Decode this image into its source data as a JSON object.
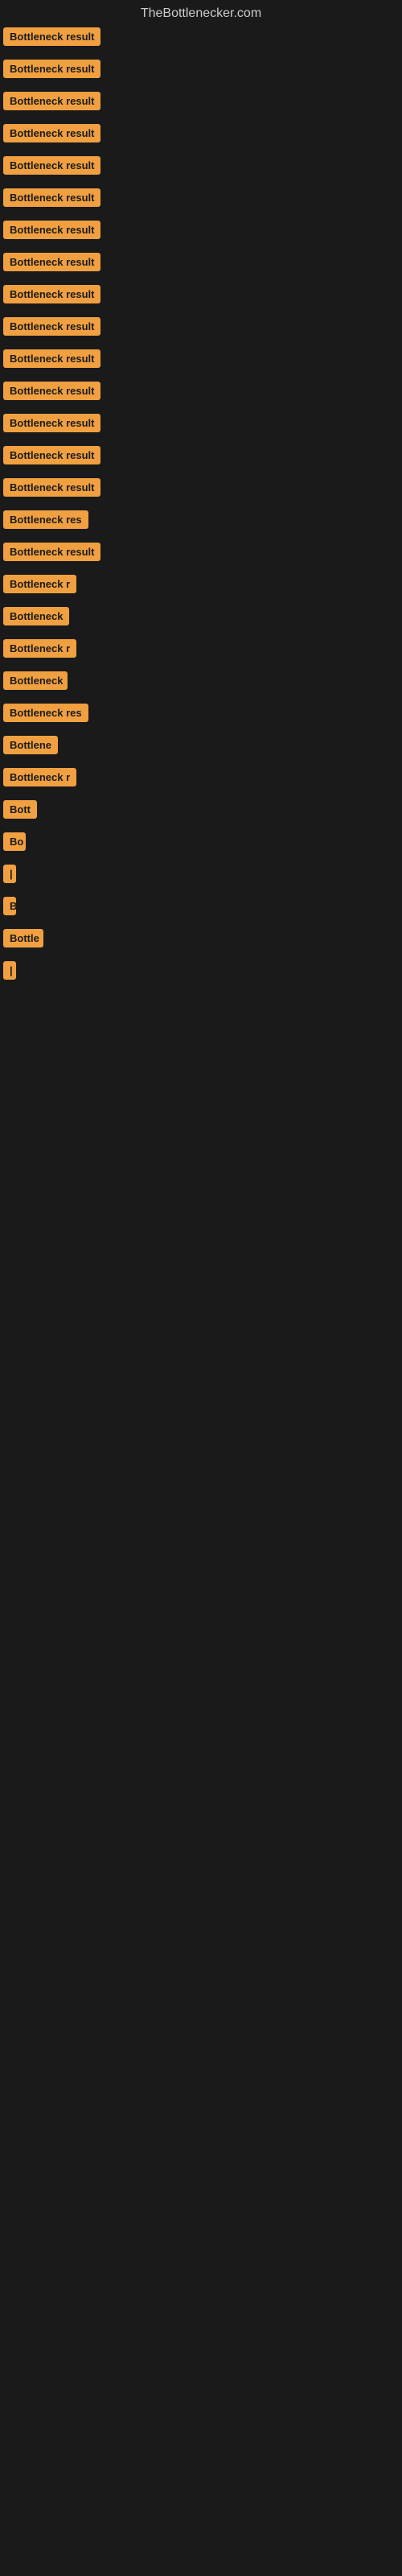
{
  "header": {
    "title": "TheBottlenecker.com"
  },
  "items": [
    {
      "label": "Bottleneck result",
      "width": 150
    },
    {
      "label": "Bottleneck result",
      "width": 150
    },
    {
      "label": "Bottleneck result",
      "width": 150
    },
    {
      "label": "Bottleneck result",
      "width": 150
    },
    {
      "label": "Bottleneck result",
      "width": 150
    },
    {
      "label": "Bottleneck result",
      "width": 150
    },
    {
      "label": "Bottleneck result",
      "width": 150
    },
    {
      "label": "Bottleneck result",
      "width": 150
    },
    {
      "label": "Bottleneck result",
      "width": 150
    },
    {
      "label": "Bottleneck result",
      "width": 150
    },
    {
      "label": "Bottleneck result",
      "width": 150
    },
    {
      "label": "Bottleneck result",
      "width": 150
    },
    {
      "label": "Bottleneck result",
      "width": 150
    },
    {
      "label": "Bottleneck result",
      "width": 145
    },
    {
      "label": "Bottleneck result",
      "width": 140
    },
    {
      "label": "Bottleneck res",
      "width": 122
    },
    {
      "label": "Bottleneck result",
      "width": 156
    },
    {
      "label": "Bottleneck r",
      "width": 100
    },
    {
      "label": "Bottleneck",
      "width": 82
    },
    {
      "label": "Bottleneck r",
      "width": 100
    },
    {
      "label": "Bottleneck",
      "width": 80
    },
    {
      "label": "Bottleneck res",
      "width": 122
    },
    {
      "label": "Bottlene",
      "width": 70
    },
    {
      "label": "Bottleneck r",
      "width": 98
    },
    {
      "label": "Bott",
      "width": 42
    },
    {
      "label": "Bo",
      "width": 28
    },
    {
      "label": "|",
      "width": 10
    },
    {
      "label": "B",
      "width": 16
    },
    {
      "label": "Bottle",
      "width": 50
    },
    {
      "label": "|",
      "width": 10
    },
    {
      "label": "",
      "width": 0
    },
    {
      "label": "",
      "width": 0
    },
    {
      "label": "",
      "width": 0
    },
    {
      "label": "",
      "width": 0
    },
    {
      "label": "",
      "width": 0
    },
    {
      "label": "",
      "width": 0
    }
  ]
}
